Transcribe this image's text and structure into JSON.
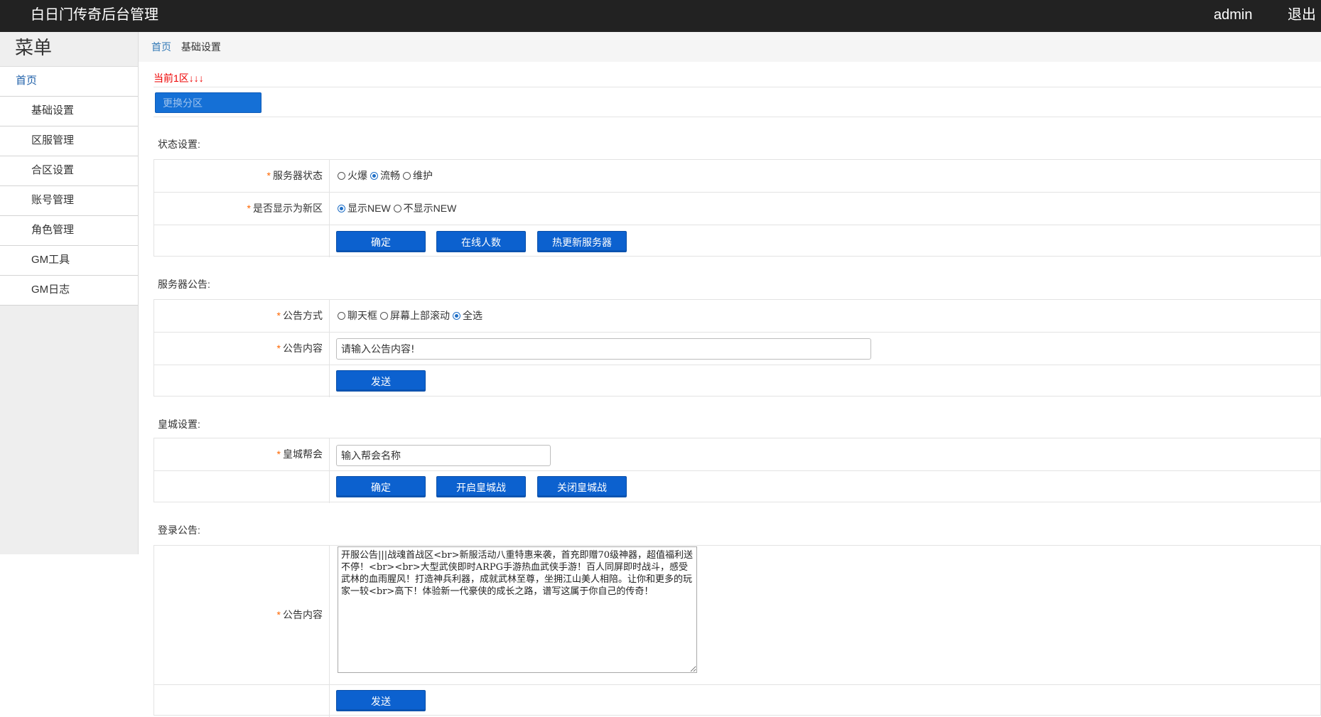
{
  "header": {
    "brand": "白日门传奇后台管理",
    "user": "admin",
    "logout": "退出"
  },
  "sidebar": {
    "title": "菜单",
    "home": "首页",
    "items": [
      "基础设置",
      "区服管理",
      "合区设置",
      "账号管理",
      "角色管理",
      "GM工具",
      "GM日志"
    ]
  },
  "breadcrumb": {
    "home": "首页",
    "current": "基础设置"
  },
  "zone": {
    "current": "当前1区↓↓↓",
    "change_button": "更换分区"
  },
  "status_section": {
    "title": "状态设置:",
    "server_status": {
      "label": "服务器状态",
      "options": [
        "火爆",
        "流畅",
        "维护"
      ],
      "selected": "流畅"
    },
    "show_new": {
      "label": "是否显示为新区",
      "options": [
        "显示NEW",
        "不显示NEW"
      ],
      "selected": "显示NEW"
    },
    "buttons": {
      "confirm": "确定",
      "online": "在线人数",
      "hot_update": "热更新服务器"
    }
  },
  "notice_section": {
    "title": "服务器公告:",
    "method": {
      "label": "公告方式",
      "options": [
        "聊天框",
        "屏幕上部滚动",
        "全选"
      ],
      "selected": "全选"
    },
    "content": {
      "label": "公告内容",
      "value": "请输入公告内容!"
    },
    "send_button": "发送"
  },
  "castle_section": {
    "title": "皇城设置:",
    "guild": {
      "label": "皇城帮会",
      "value": "输入帮会名称"
    },
    "buttons": {
      "confirm": "确定",
      "open_war": "开启皇城战",
      "close_war": "关闭皇城战"
    }
  },
  "login_section": {
    "title": "登录公告:",
    "content_label": "公告内容",
    "content_value": "开服公告|||战魂首战区<br>新服活动八重特惠来袭，首充即赠70级神器，超值福利送不停！<br><br>大型武侠即时ARPG手游热血武侠手游！百人同屏即时战斗，感受武林的血雨腥风！打造神兵利器，成就武林至尊，坐拥江山美人相陪。让你和更多的玩家一较<br>高下！体验新一代豪侠的成长之路，谱写这属于你自己的传奇！",
    "send_button": "发送"
  },
  "colors": {
    "topbar": "#222222",
    "button": "#0c61cf",
    "required_star": "#ff6600",
    "zone_text": "#ee0000",
    "link": "#337ab7"
  }
}
